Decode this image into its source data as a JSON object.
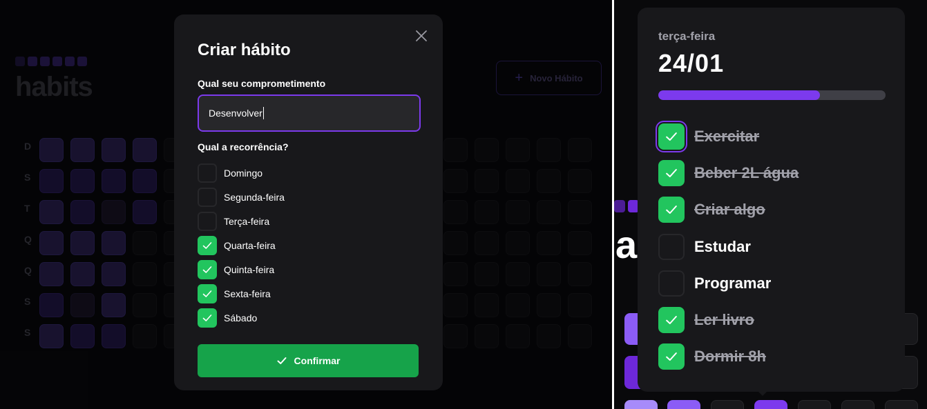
{
  "left_panel": {
    "background": {
      "logo_text": "habits",
      "new_habit_button": "Novo Hábito",
      "weekdays": [
        "D",
        "S",
        "T",
        "Q",
        "Q",
        "S",
        "S"
      ]
    },
    "modal": {
      "title": "Criar hábito",
      "commitment_label": "Qual seu comprometimento",
      "commitment_value": "Desenvolver",
      "recurrence_label": "Qual a recorrência?",
      "days": [
        {
          "label": "Domingo",
          "checked": false
        },
        {
          "label": "Segunda-feira",
          "checked": false
        },
        {
          "label": "Terça-feira",
          "checked": false
        },
        {
          "label": "Quarta-feira",
          "checked": true
        },
        {
          "label": "Quinta-feira",
          "checked": true
        },
        {
          "label": "Sexta-feira",
          "checked": true
        },
        {
          "label": "Sábado",
          "checked": true
        }
      ],
      "confirm_label": "Confirmar"
    }
  },
  "right_panel": {
    "popover": {
      "weekday": "terça-feira",
      "date": "24/01",
      "progress_fraction": 0.71,
      "habits": [
        {
          "label": "Exercitar",
          "completed": true
        },
        {
          "label": "Beber 2L água",
          "completed": true
        },
        {
          "label": "Criar algo",
          "completed": true
        },
        {
          "label": "Estudar",
          "completed": false
        },
        {
          "label": "Programar",
          "completed": false
        },
        {
          "label": "Ler livro",
          "completed": true
        },
        {
          "label": "Dormir 8h",
          "completed": true
        }
      ]
    },
    "background_logo_fragment": "a"
  },
  "colors": {
    "accent": "#7c3aed",
    "success": "#22c55e",
    "confirm": "#16a34a",
    "surface": "#18181b"
  }
}
